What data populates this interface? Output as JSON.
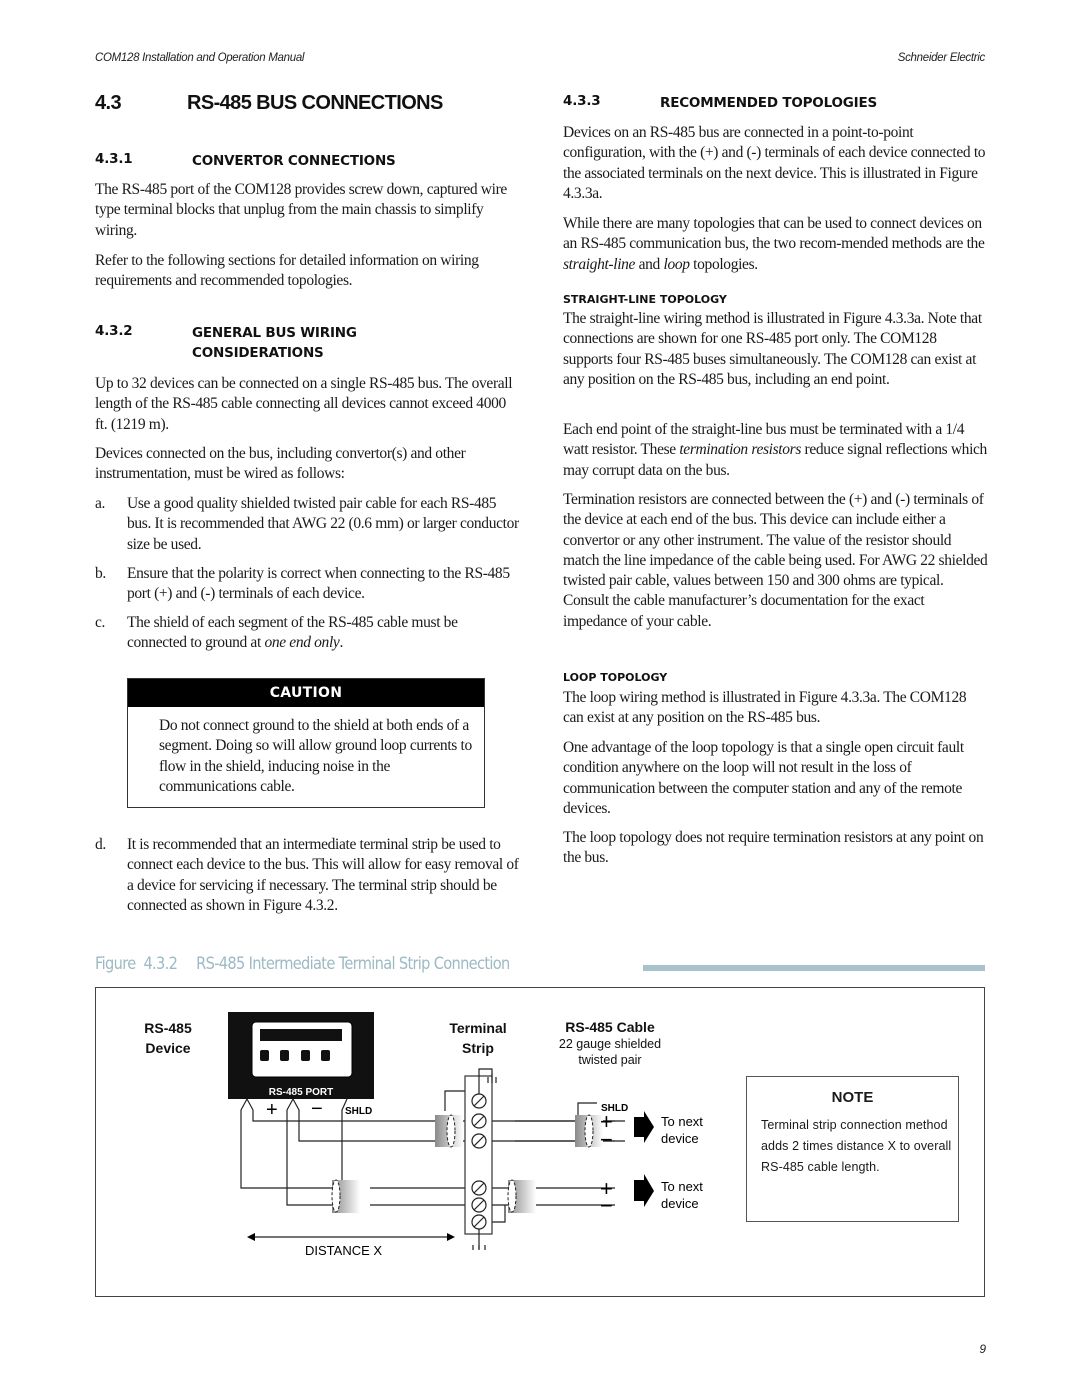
{
  "header": {
    "manual_title": "COM128 Installation and Operation Manual",
    "company": "Schneider Electric"
  },
  "section": {
    "number": "4.3",
    "title": "RS-485 BUS CONNECTIONS"
  },
  "s431": {
    "number": "4.3.1",
    "title": "CONVERTOR CONNECTIONS",
    "paragraphs": [
      "The RS-485 port of the COM128 provides screw down, captured wire type terminal blocks that unplug from the main chassis to simplify wiring.",
      "Refer to the following sections for detailed information on wiring requirements and recommended topologies."
    ]
  },
  "s432": {
    "number": "4.3.2",
    "title_line1": "GENERAL BUS WIRING",
    "title_line2": "CONSIDERATIONS",
    "paragraphs": [
      "Up to 32 devices can be connected on a single RS-485 bus.  The overall length of the RS-485 cable connecting all devices cannot exceed 4000 ft. (1219 m).",
      "Devices connected on the bus, including convertor(s) and other instrumentation, must be wired as follows:"
    ],
    "list": [
      {
        "marker": "a.",
        "text": "Use a good quality shielded twisted pair cable for each RS-485 bus.  It is recommended that AWG 22 (0.6 mm) or larger conductor size be used."
      },
      {
        "marker": "b.",
        "text": "Ensure that the polarity is correct when connecting to the RS-485 port (+) and (-) terminals of each device."
      },
      {
        "marker": "c.",
        "text": "The shield of each segment of the RS-485 cable must be connected to ground at ",
        "emphasis": "one end only",
        "suffix": "."
      },
      {
        "marker": "d.",
        "text": "It is recommended that an intermediate terminal strip be used to connect each device to the bus.  This will allow for easy removal of a device for servicing if necessary.  The terminal strip should be connected as shown in Figure 4.3.2."
      }
    ],
    "caution": {
      "heading": "CAUTION",
      "text": "Do not connect ground to the shield at both ends of a segment.  Doing so will allow ground loop currents to flow in the shield, inducing noise in the communications cable."
    }
  },
  "s433": {
    "number": "4.3.3",
    "title": "RECOMMENDED TOPOLOGIES",
    "intro": [
      "Devices on an RS-485 bus are connected in a point-to-point configuration, with the (+) and (-) terminals of each device connected to the associated terminals on the next device.  This is illustrated in Figure 4.3.3a."
    ],
    "intro2": {
      "before": "While there are many topologies that can be used to connect devices on an RS-485 communication bus, the two recom-mended methods are the ",
      "em1": "straight-line",
      "mid": " and ",
      "em2": "loop",
      "after": " topologies."
    },
    "straight_line": {
      "heading": "STRAIGHT-LINE  TOPOLOGY",
      "p1": "The straight-line wiring method is illustrated in Figure 4.3.3a. Note that connections are shown for one RS-485 port only.  The COM128 supports four RS-485 buses simultaneously.  The COM128 can exist at any position on the RS-485 bus, including an end point.",
      "p2_before": "Each end point of the straight-line bus must be terminated with a 1/4 watt resistor.  These ",
      "p2_em": "termination resistors",
      "p2_after": " reduce signal reflections which may corrupt data on the bus.",
      "p3": "Termination resistors are connected between the (+) and (-) terminals of the device at each end of the bus.  This device can include either a convertor or any other instrument.  The value of the resistor should match the line impedance of the cable being used. For AWG 22 shielded twisted pair cable, values between 150 and 300 ohms are typical.  Consult the cable manufacturer’s documentation for the exact impedance of your cable."
    },
    "loop": {
      "heading": "LOOP  TOPOLOGY",
      "p1": "The loop wiring method is illustrated in Figure 4.3.3a. The COM128 can exist at any position on the RS-485 bus.",
      "p2": "One advantage of the loop topology is that a single open circuit fault condition anywhere on the loop will not result in the loss of communication between the computer station and any of the remote devices.",
      "p3": "The loop topology does not require termination resistors at any point on the bus."
    }
  },
  "figure": {
    "label": "Figure",
    "number": "4.3.2",
    "title": "RS-485 Intermediate Terminal Strip Connection",
    "accent_color": "#a9c3cc",
    "device_label_line1": "RS-485",
    "device_label_line2": "Device",
    "port_label": "RS-485 PORT",
    "plus": "+",
    "minus": "−",
    "shld": "SHLD",
    "terminal_line1": "Terminal",
    "terminal_line2": "Strip",
    "cable_title": "RS-485 Cable",
    "cable_sub1": "22 gauge shielded",
    "cable_sub2": "twisted pair",
    "to_next_1": "To next",
    "to_next_2": "device",
    "distance": "DISTANCE X",
    "icons": [
      "ground-icon",
      "screw-terminal-icon",
      "arrow-right-icon",
      "cable-shield-icon"
    ],
    "note": {
      "heading": "NOTE",
      "text": "Terminal strip connection method adds 2 times distance X to overall RS-485 cable length."
    }
  },
  "page_number": "9"
}
